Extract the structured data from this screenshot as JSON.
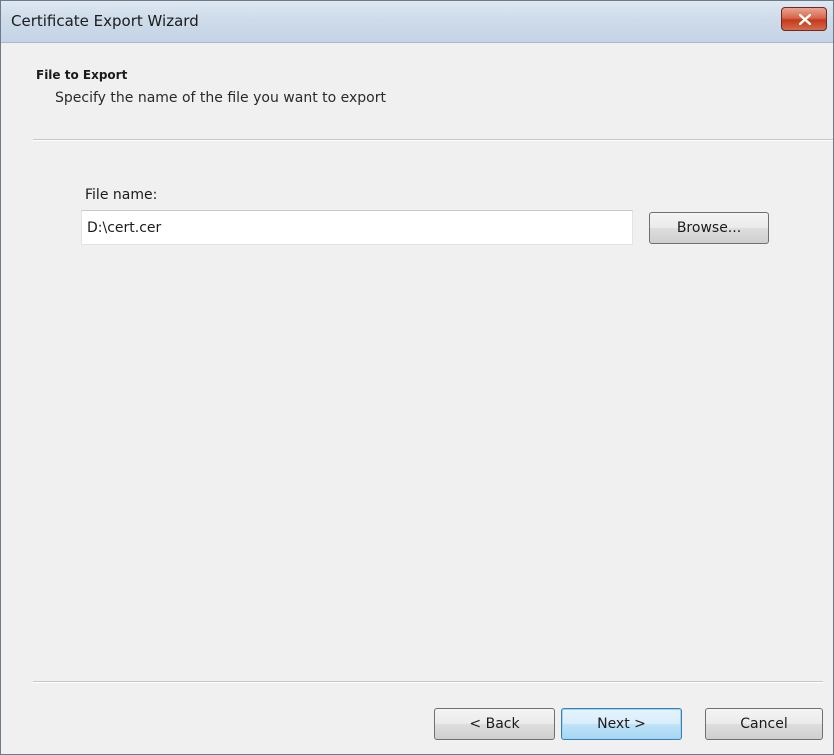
{
  "window": {
    "title": "Certificate Export Wizard"
  },
  "header": {
    "title": "File to Export",
    "subtitle": "Specify the name of the file you want to export"
  },
  "file": {
    "label": "File name:",
    "value": "D:\\cert.cer",
    "browse_label": "Browse..."
  },
  "footer": {
    "back_label": "< Back",
    "next_label": "Next >",
    "cancel_label": "Cancel"
  },
  "colors": {
    "titlebar": "#cddbea",
    "close_button": "#c33a1d",
    "default_button_border": "#3c7fb1",
    "background": "#f0f0f0"
  },
  "icons": {
    "close": "close-icon"
  }
}
